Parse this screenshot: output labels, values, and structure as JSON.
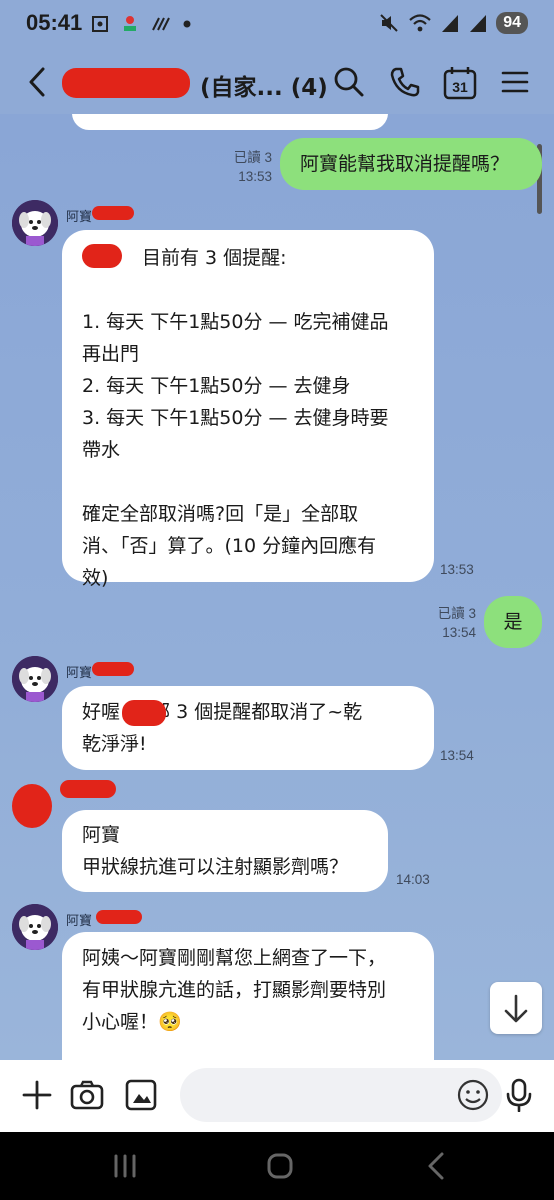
{
  "status_bar": {
    "time": "05:41",
    "battery": "94"
  },
  "header": {
    "title": "(自家... (4)",
    "back_icon": "chevron-left-icon",
    "icons": [
      "search-icon",
      "phone-icon",
      "calendar-icon",
      "menu-icon"
    ],
    "calendar_day": "31"
  },
  "messages": [
    {
      "sender": "me",
      "text": "阿寶能幫我取消提醒嗎？",
      "read": "已讀 3",
      "time": "13:53"
    },
    {
      "sender": "bot",
      "name": "阿寶",
      "lines": [
        "目前有 3 個提醒:",
        "",
        "1. 每天 下午1點50分 — 吃完補健品",
        "再出門",
        "2. 每天 下午1點50分 — 去健身",
        "3. 每天 下午1點50分 — 去健身時要",
        "帶水",
        "",
        "確定全部取消嗎?回「是」全部取",
        "消、「否」算了。(10 分鐘內回應有",
        "效)"
      ],
      "time": "13:53"
    },
    {
      "sender": "me",
      "text": "是",
      "read": "已讀 3",
      "time": "13:54"
    },
    {
      "sender": "bot",
      "name": "阿寶",
      "lines": [
        "好喔       ,全部 3 個提醒都取消了~乾",
        "乾淨淨!"
      ],
      "time": "13:54"
    },
    {
      "sender": "user",
      "lines": [
        "阿寶",
        "甲狀線抗進可以注射顯影劑嗎？"
      ],
      "time": "14:03"
    },
    {
      "sender": "bot",
      "name": "阿寶",
      "lines": [
        "阿姨～阿寶剛剛幫您上網查了一下，",
        "有甲狀腺亢進的話，打顯影劑要特別",
        "小心喔！🥺"
      ]
    }
  ],
  "input_bar": {
    "icons": [
      "plus-icon",
      "camera-icon",
      "image-icon",
      "emoji-icon",
      "microphone-icon"
    ],
    "placeholder": ""
  },
  "colors": {
    "chat_bg": "#8aa8d4",
    "my_bubble": "#8de07c",
    "other_bubble": "#ffffff",
    "redaction": "#e12419"
  }
}
